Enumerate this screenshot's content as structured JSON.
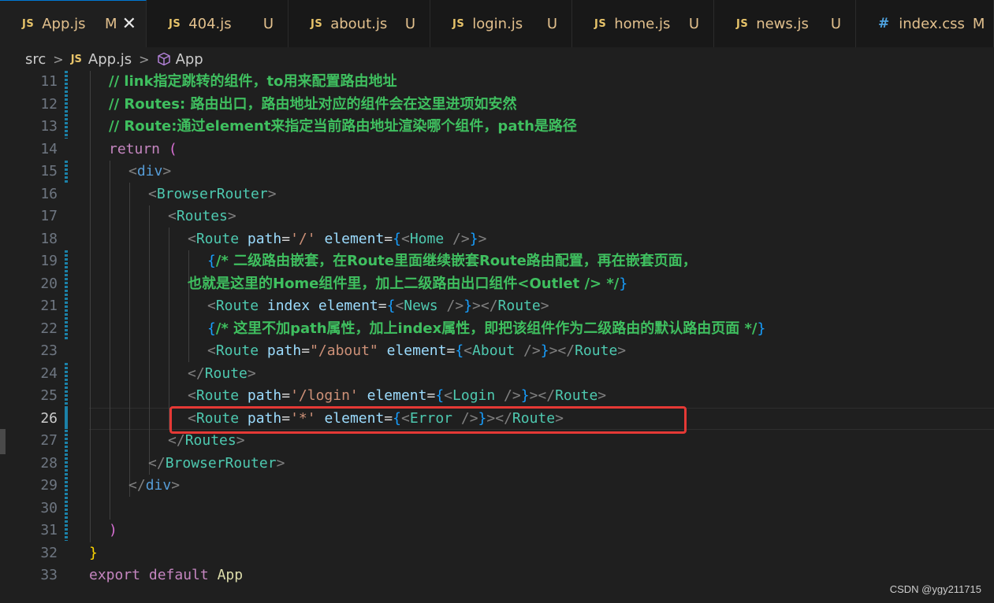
{
  "tabs": [
    {
      "icon": "JS",
      "name": "App.js",
      "status": "M",
      "active": true
    },
    {
      "icon": "JS",
      "name": "404.js",
      "status": "U"
    },
    {
      "icon": "JS",
      "name": "about.js",
      "status": "U"
    },
    {
      "icon": "JS",
      "name": "login.js",
      "status": "U"
    },
    {
      "icon": "JS",
      "name": "home.js",
      "status": "U"
    },
    {
      "icon": "JS",
      "name": "news.js",
      "status": "U"
    },
    {
      "icon": "#",
      "name": "index.css",
      "status": "M"
    }
  ],
  "breadcrumb": {
    "folder": "src",
    "file_icon": "JS",
    "file": "App.js",
    "symbol": "App"
  },
  "line_numbers": [
    "11",
    "12",
    "13",
    "14",
    "15",
    "16",
    "17",
    "18",
    "19",
    "20",
    "21",
    "22",
    "23",
    "24",
    "25",
    "26",
    "27",
    "28",
    "29",
    "30",
    "31",
    "32",
    "33"
  ],
  "current_line": "26",
  "code": {
    "l11": "// link指定跳转的组件，to用来配置路由地址",
    "l12": "// Routes: 路由出口，路由地址对应的组件会在这里进项如安然",
    "l13": "// Route:通过element来指定当前路由地址渲染哪个组件，path是路径",
    "l19": "/* 二级路由嵌套，在Route里面继续嵌套Route路由配置，再在嵌套页面，",
    "l20": "也就是这里的Home组件里，加上二级路由出口组件<Outlet /> */",
    "l22": "/* 这里不加path属性，加上index属性，即把该组件作为二级路由的默认路由页面 */",
    "return_kw": "return",
    "div": "div",
    "browser_router": "BrowserRouter",
    "routes": "Routes",
    "route": "Route",
    "path_attr": "path",
    "element_attr": "element",
    "index_attr": "index",
    "p_root": "'/'",
    "p_about": "\"/about\"",
    "p_login": "'/login'",
    "p_star": "'*'",
    "home": "Home",
    "news": "News",
    "about": "About",
    "login": "Login",
    "error": "Error",
    "export_kw": "export",
    "default_kw": "default",
    "app": "App"
  },
  "watermark": "CSDN @ygy211715",
  "colors": {
    "modified": "#e2c08d",
    "keyword": "#569cd6",
    "component": "#4ec9b0",
    "attribute": "#9cdcfe",
    "string": "#ce9178",
    "comment": "#3fbf5f",
    "highlight": "#e53935"
  }
}
